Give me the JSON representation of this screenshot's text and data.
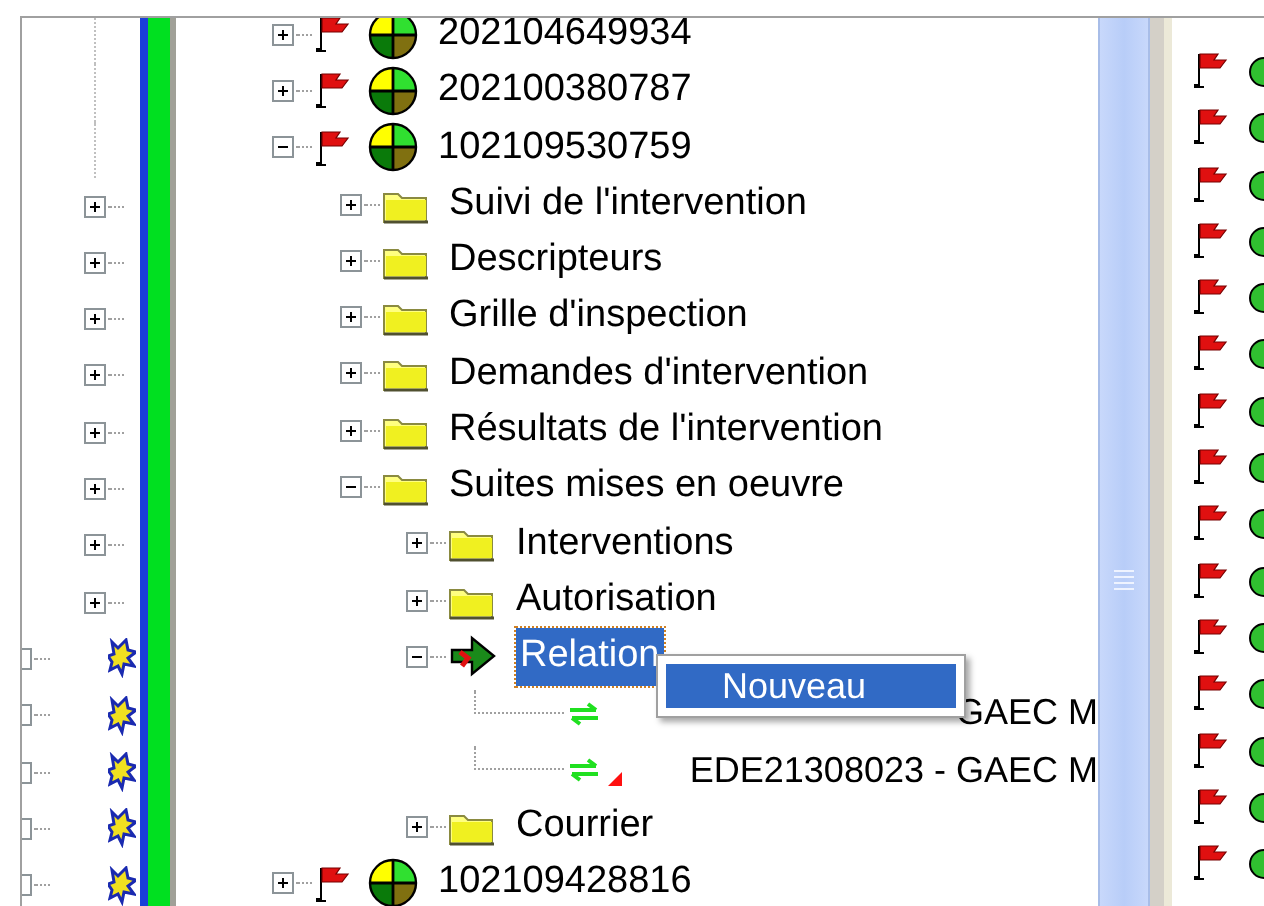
{
  "left_column": [
    {
      "kind": "line"
    },
    {
      "kind": "line"
    },
    {
      "kind": "line"
    },
    {
      "kind": "node"
    },
    {
      "kind": "node"
    },
    {
      "kind": "node"
    },
    {
      "kind": "node"
    },
    {
      "kind": "node"
    },
    {
      "kind": "node"
    },
    {
      "kind": "node"
    },
    {
      "kind": "node"
    },
    {
      "kind": "star"
    },
    {
      "kind": "star"
    },
    {
      "kind": "star"
    },
    {
      "kind": "star"
    },
    {
      "kind": "star"
    }
  ],
  "tree": [
    {
      "label": "202104649934",
      "kind": "record",
      "expanded": false,
      "selected": false
    },
    {
      "label": "202100380787",
      "kind": "record",
      "expanded": false,
      "selected": false
    },
    {
      "label": "102109530759",
      "kind": "record",
      "expanded": true,
      "selected": false,
      "children": [
        {
          "label": "Suivi de l'intervention",
          "kind": "folder",
          "expanded": false,
          "selected": false
        },
        {
          "label": "Descripteurs",
          "kind": "folder",
          "expanded": false,
          "selected": false
        },
        {
          "label": "Grille d'inspection",
          "kind": "folder",
          "expanded": false,
          "selected": false
        },
        {
          "label": "Demandes d'intervention",
          "kind": "folder",
          "expanded": false,
          "selected": false
        },
        {
          "label": "Résultats de l'intervention",
          "kind": "folder",
          "expanded": false,
          "selected": false
        },
        {
          "label": "Suites mises en oeuvre",
          "kind": "folder",
          "expanded": true,
          "selected": false,
          "children": [
            {
              "label": "Interventions",
              "kind": "folder",
              "expanded": false,
              "selected": false
            },
            {
              "label": "Autorisation",
              "kind": "folder",
              "expanded": false,
              "selected": false
            },
            {
              "label": "Relation",
              "kind": "relation",
              "expanded": true,
              "selected": true,
              "children": [
                {
                  "label": "GAEC M",
                  "kind": "link",
                  "warning": false,
                  "selected": false
                },
                {
                  "label": "EDE21308023 - GAEC M",
                  "kind": "link",
                  "warning": true,
                  "selected": false
                }
              ]
            },
            {
              "label": "Courrier",
              "kind": "folder",
              "expanded": false,
              "selected": false
            }
          ]
        }
      ]
    },
    {
      "label": "102109428816",
      "kind": "record",
      "expanded": false,
      "selected": false
    }
  ],
  "context_menu": {
    "items": [
      {
        "label": "Nouveau",
        "selected": true
      }
    ]
  }
}
